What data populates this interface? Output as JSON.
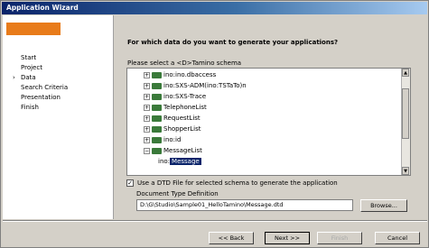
{
  "window": {
    "title": "Application Wizard"
  },
  "sidebar": {
    "steps": [
      {
        "label": "Start",
        "current": false
      },
      {
        "label": "Project",
        "current": false
      },
      {
        "label": "Data",
        "current": true
      },
      {
        "label": "Search Criteria",
        "current": false
      },
      {
        "label": "Presentation",
        "current": false
      },
      {
        "label": "Finish",
        "current": false
      }
    ]
  },
  "main": {
    "heading": "For which data do you want to generate your applications?",
    "prompt": "Please select a <D>Tamino schema",
    "tree": [
      {
        "label": "ino:ino.dbaccess",
        "expander": "+"
      },
      {
        "label": "ino:SXS-ADM(ino:TSTaTo)n",
        "expander": "+"
      },
      {
        "label": "ino:SXS-Trace",
        "expander": "+"
      },
      {
        "label": "TelephoneList",
        "expander": "+"
      },
      {
        "label": "RequestList",
        "expander": "+"
      },
      {
        "label": "ShopperList",
        "expander": "+"
      },
      {
        "label": "ino:id",
        "expander": "+"
      },
      {
        "label": "MessageList",
        "expander": "−"
      },
      {
        "label": "Message",
        "expander": "",
        "selected": true,
        "prefix": "ino:"
      }
    ],
    "use_dtd_label": "Use a DTD File for selected schema to generate the application",
    "use_dtd_checked": true,
    "dtd_label": "Document Type Definition",
    "dtd_path": "D:\\G\\Studio\\Sample01_HelloTamino\\Message.dtd",
    "browse_label": "Browse..."
  },
  "buttons": {
    "back": "<< Back",
    "next": "Next >>",
    "finish": "Finish",
    "cancel": "Cancel"
  }
}
